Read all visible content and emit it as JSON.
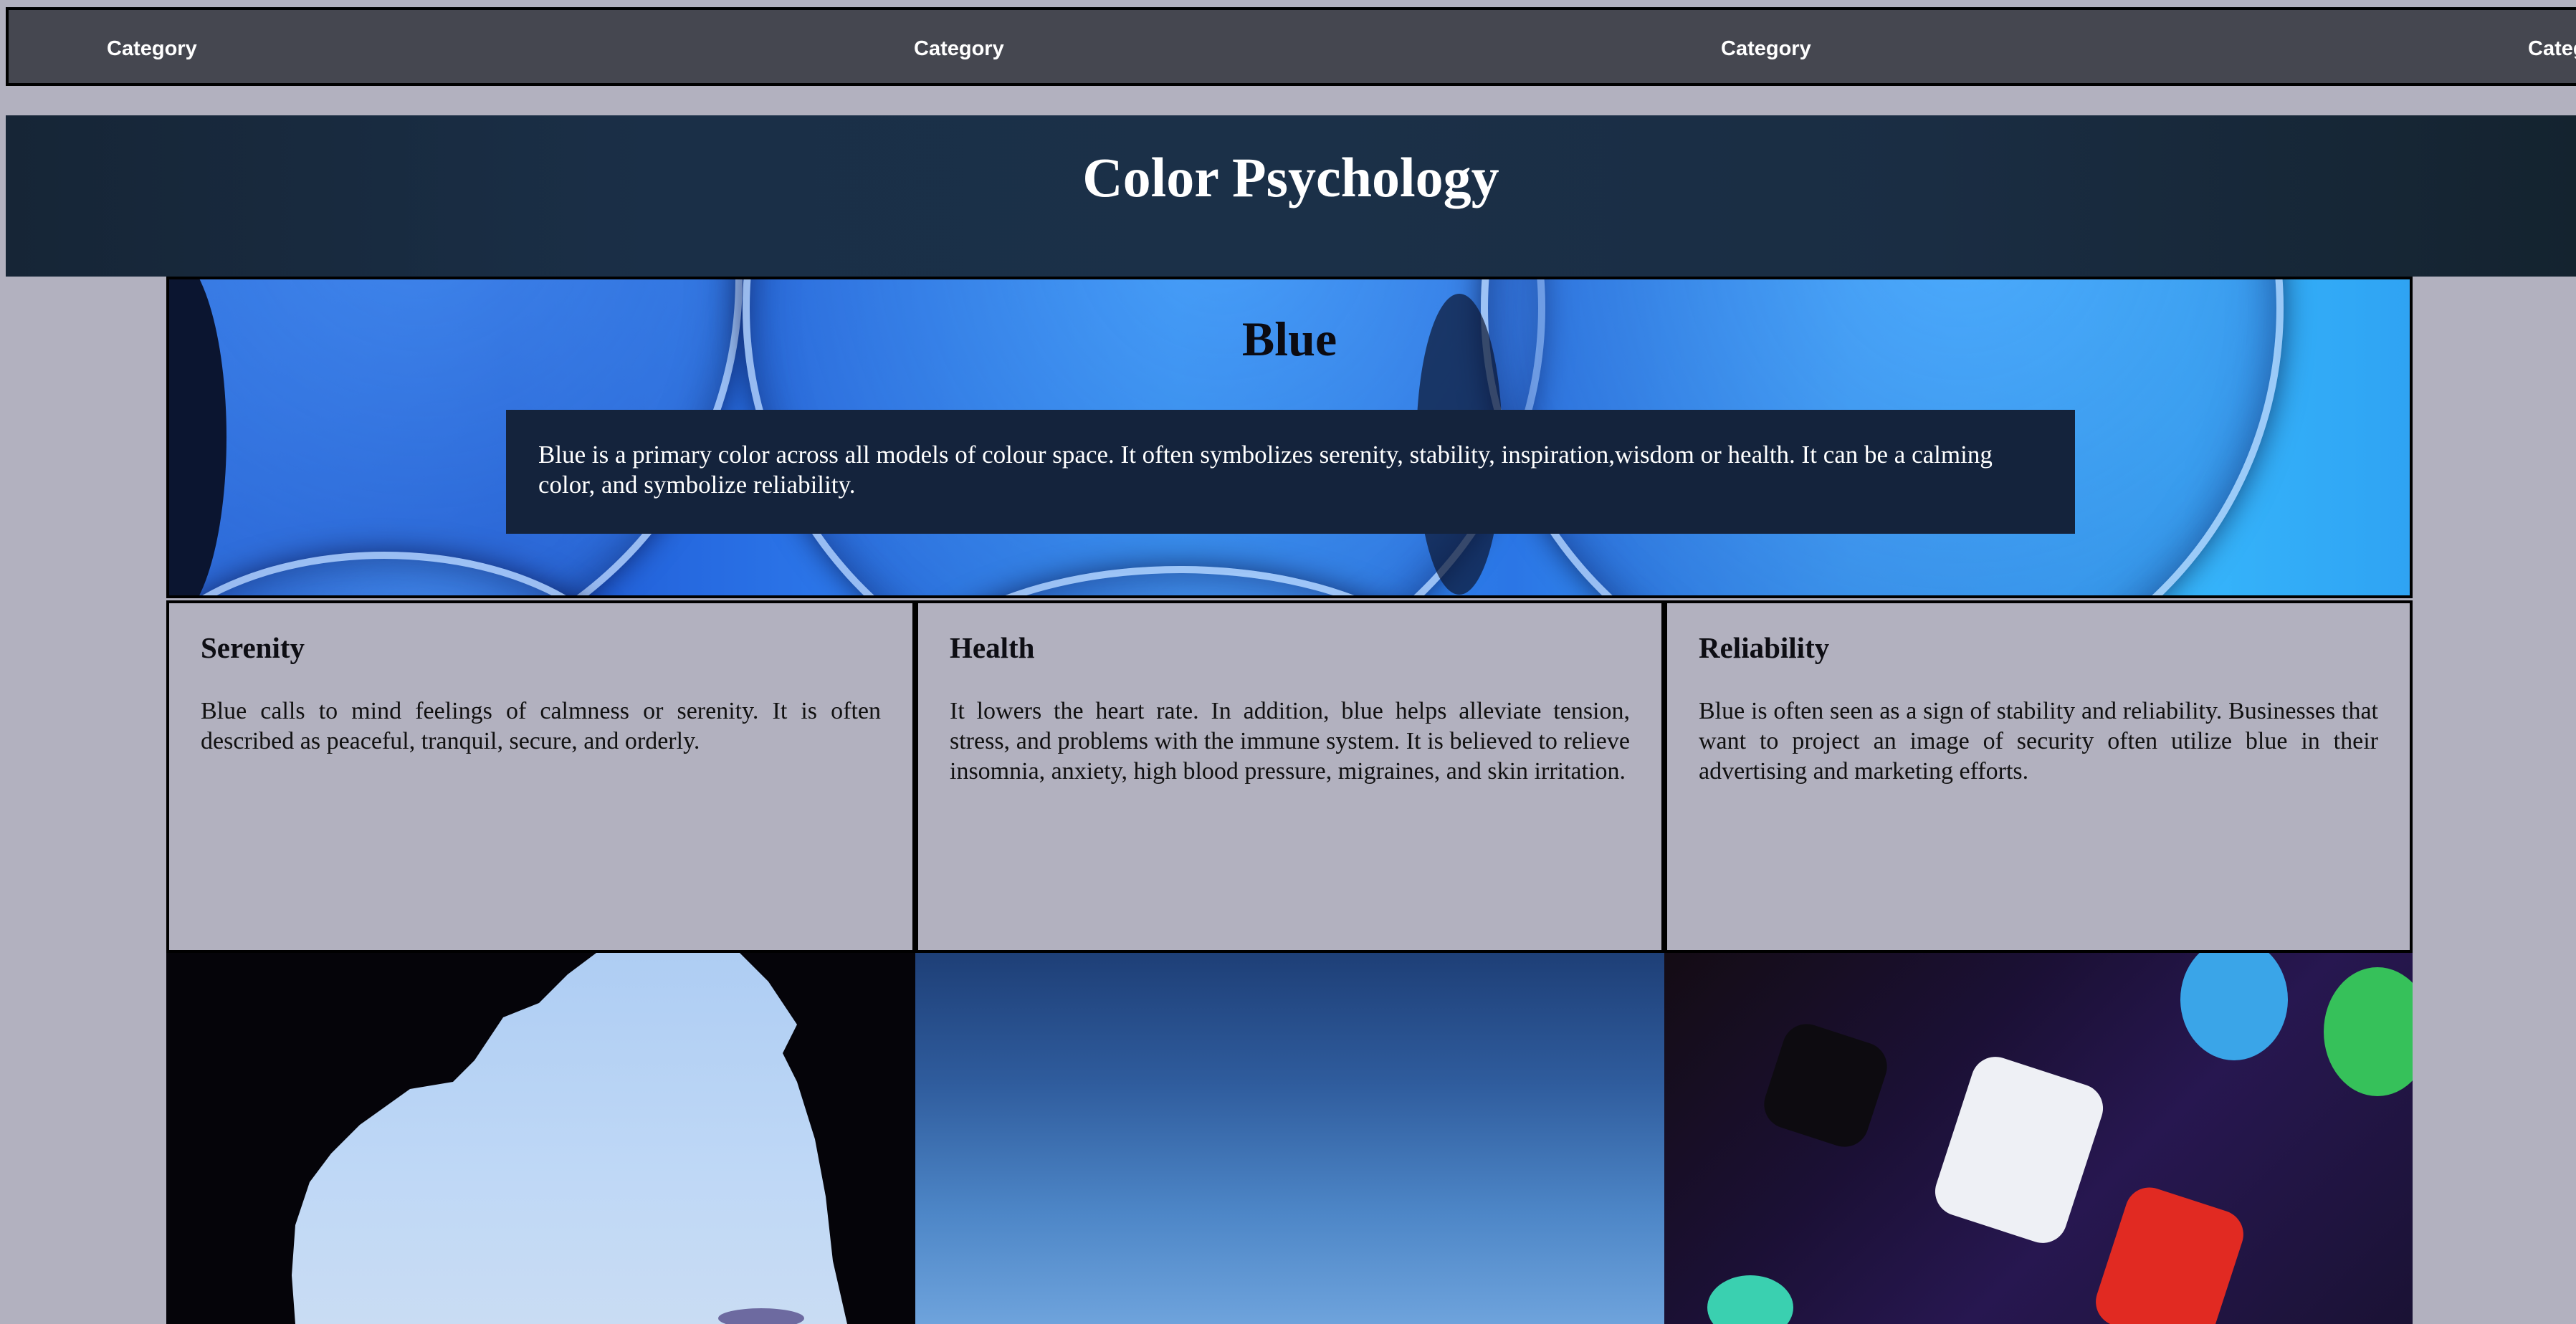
{
  "nav": {
    "items": [
      "Category",
      "Category",
      "Category",
      "Categ"
    ]
  },
  "header": {
    "title": "Color Psychology"
  },
  "hero": {
    "title": "Blue",
    "description": "Blue is a primary color across all models of colour space. It often symbolizes serenity, stability, inspiration,wisdom or health. It can be a calming color, and symbolize reliability."
  },
  "cards": [
    {
      "title": "Serenity",
      "text": "Blue calls to mind feelings of calmness or serenity. It is often described as peaceful, tranquil, secure, and orderly."
    },
    {
      "title": "Health",
      "text": "It lowers the heart rate. In addition, blue helps alleviate tension, stress, and problems with the immune system. It is believed to relieve insomnia, anxiety, high blood pressure, migraines, and skin irritation."
    },
    {
      "title": "Reliability",
      "text": "Blue is often seen as a sign of stability and reliability. Businesses that want to project an image of security often utilize blue in their advertising and marketing efforts."
    }
  ],
  "colors": {
    "nav_bg": "#454750",
    "page_bg": "#b2b1bf",
    "header_bg": "#1a2f47",
    "desc_box_bg": "#14233c",
    "accent_blue": "#2c77ea"
  }
}
